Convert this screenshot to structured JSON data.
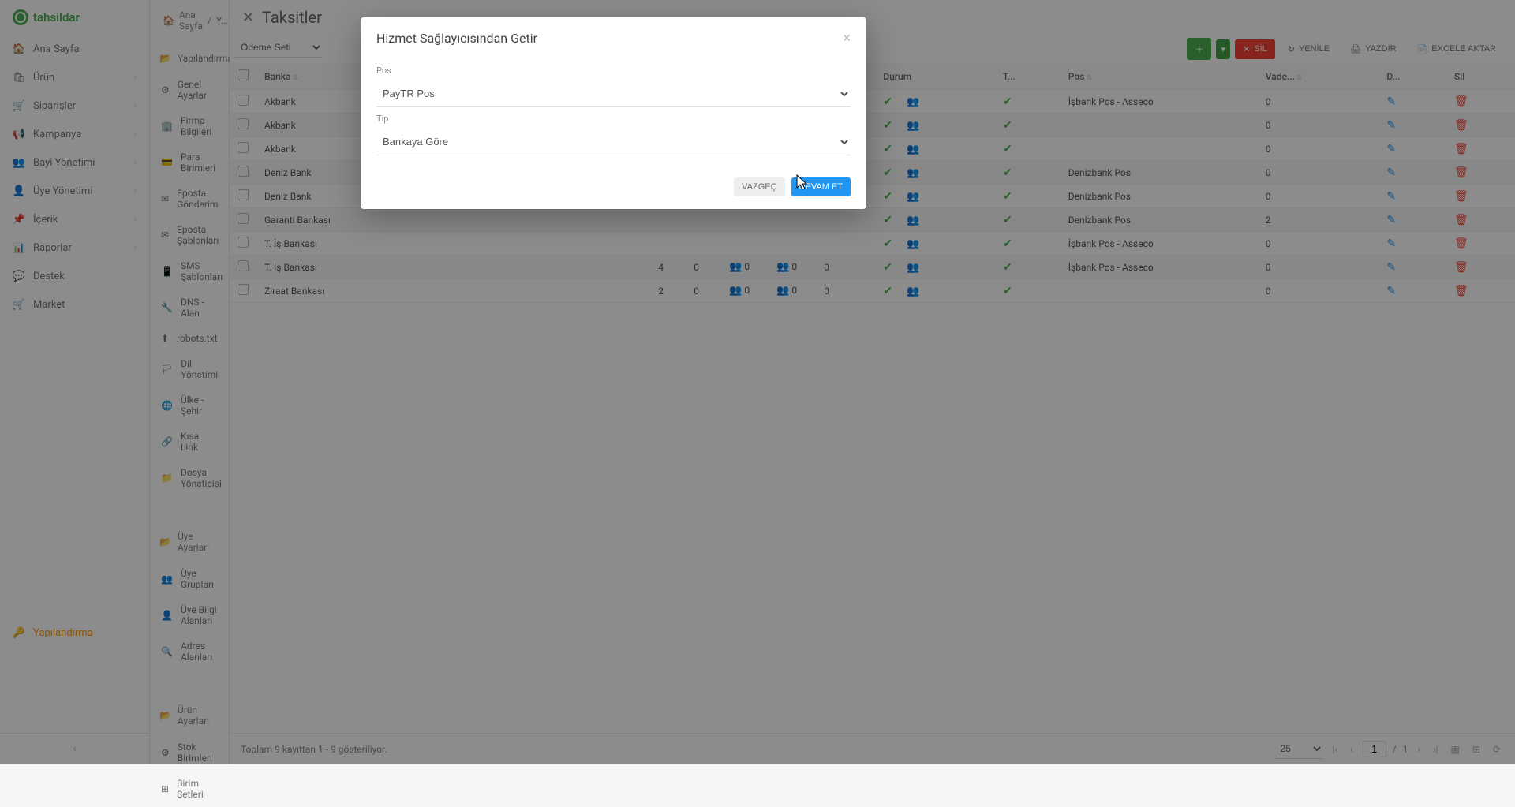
{
  "logo": "tahsildar",
  "sidebar": {
    "items": [
      {
        "label": "Ana Sayfa",
        "icon": "🏠"
      },
      {
        "label": "Ürün",
        "icon": "🛍"
      },
      {
        "label": "Siparişler",
        "icon": "🛒"
      },
      {
        "label": "Kampanya",
        "icon": "📢"
      },
      {
        "label": "Bayi Yönetimi",
        "icon": "👥"
      },
      {
        "label": "Üye Yönetimi",
        "icon": "👤"
      },
      {
        "label": "İçerik",
        "icon": "📌"
      },
      {
        "label": "Raporlar",
        "icon": "📊"
      },
      {
        "label": "Destek",
        "icon": "💬"
      },
      {
        "label": "Market",
        "icon": "🛒"
      },
      {
        "label": "Yapılandırma",
        "icon": "🔑"
      }
    ]
  },
  "breadcrumb": {
    "home": "Ana Sayfa",
    "sep": "/",
    "page": "Yapılandırma"
  },
  "subsidebar": {
    "section1": {
      "title": "Yapılandırma",
      "items": [
        {
          "label": "Genel Ayarlar",
          "icon": "⚙"
        },
        {
          "label": "Firma Bilgileri",
          "icon": "🏢"
        },
        {
          "label": "Para Birimleri",
          "icon": "💳"
        },
        {
          "label": "Eposta Gönderim",
          "icon": "✉"
        },
        {
          "label": "Eposta Şablonları",
          "icon": "✉"
        },
        {
          "label": "SMS Şablonları",
          "icon": "📱"
        },
        {
          "label": "DNS - Alan",
          "icon": "🔧"
        },
        {
          "label": "robots.txt",
          "icon": "⬆"
        },
        {
          "label": "Dil Yönetimi",
          "icon": "🏳"
        },
        {
          "label": "Ülke - Şehir",
          "icon": "🌐"
        },
        {
          "label": "Kısa Link",
          "icon": "🔗"
        },
        {
          "label": "Dosya Yöneticisi",
          "icon": "📁"
        }
      ]
    },
    "section2": {
      "title": "Üye Ayarları",
      "items": [
        {
          "label": "Üye Grupları",
          "icon": "👥"
        },
        {
          "label": "Üye Bilgi Alanları",
          "icon": "👤"
        },
        {
          "label": "Adres Alanları",
          "icon": "🔍"
        }
      ]
    },
    "section3": {
      "title": "Ürün Ayarları",
      "items": [
        {
          "label": "Stok Birimleri",
          "icon": "⚙"
        },
        {
          "label": "Birim Setleri",
          "icon": "⊞"
        }
      ]
    }
  },
  "panel": {
    "title": "Taksitler",
    "odemeSeti": "Ödeme Seti"
  },
  "toolbar": {
    "yenile": "YENİLE",
    "yazdir": "YAZDIR",
    "excele": "EXCELE AKTAR",
    "sil": "SİL"
  },
  "table": {
    "headers": {
      "banka": "Banka",
      "durum": "Durum",
      "t": "T...",
      "pos": "Pos",
      "vade": "Vade...",
      "d": "D...",
      "sil": "Sil"
    },
    "rows": [
      {
        "banka": "Akbank",
        "c4": "",
        "c5": "",
        "c6": "",
        "c7": "",
        "c8": "",
        "c9": "",
        "pos": "İşbank Pos - Asseco",
        "vade": "0"
      },
      {
        "banka": "Akbank",
        "c4": "",
        "c5": "",
        "c6": "",
        "c7": "",
        "c8": "",
        "c9": "",
        "pos": "",
        "vade": "0"
      },
      {
        "banka": "Akbank",
        "c4": "",
        "c5": "",
        "c6": "",
        "c7": "",
        "c8": "",
        "c9": "",
        "pos": "",
        "vade": "0"
      },
      {
        "banka": "Deniz Bank",
        "c4": "",
        "c5": "",
        "c6": "",
        "c7": "",
        "c8": "",
        "c9": "",
        "pos": "Denizbank Pos",
        "vade": "0"
      },
      {
        "banka": "Deniz Bank",
        "c4": "",
        "c5": "",
        "c6": "",
        "c7": "",
        "c8": "",
        "c9": "",
        "pos": "Denizbank Pos",
        "vade": "0"
      },
      {
        "banka": "Garanti Bankası",
        "c4": "",
        "c5": "",
        "c6": "",
        "c7": "",
        "c8": "",
        "c9": "",
        "pos": "Denizbank Pos",
        "vade": "2"
      },
      {
        "banka": "T. İş Bankası",
        "c4": "",
        "c5": "",
        "c6": "",
        "c7": "",
        "c8": "",
        "c9": "",
        "pos": "İşbank Pos - Asseco",
        "vade": "0"
      },
      {
        "banka": "T. İş Bankası",
        "c4": "4",
        "c5": "0",
        "c6": "0",
        "c7": "0",
        "c8": "0",
        "c9": "",
        "pos": "İşbank Pos - Asseco",
        "vade": "0"
      },
      {
        "banka": "Ziraat Bankası",
        "c4": "2",
        "c5": "0",
        "c6": "0",
        "c7": "0",
        "c8": "0",
        "c9": "",
        "pos": "",
        "vade": "0"
      }
    ]
  },
  "footer": {
    "summary": "Toplam 9 kayıttan 1 - 9 gösteriliyor.",
    "pagesize": "25",
    "page": "1",
    "total": "1"
  },
  "modal": {
    "title": "Hizmet Sağlayıcısından Getir",
    "posLabel": "Pos",
    "posValue": "PayTR Pos",
    "tipLabel": "Tip",
    "tipValue": "Bankaya Göre",
    "cancel": "VAZGEÇ",
    "confirm": "DEVAM ET"
  }
}
